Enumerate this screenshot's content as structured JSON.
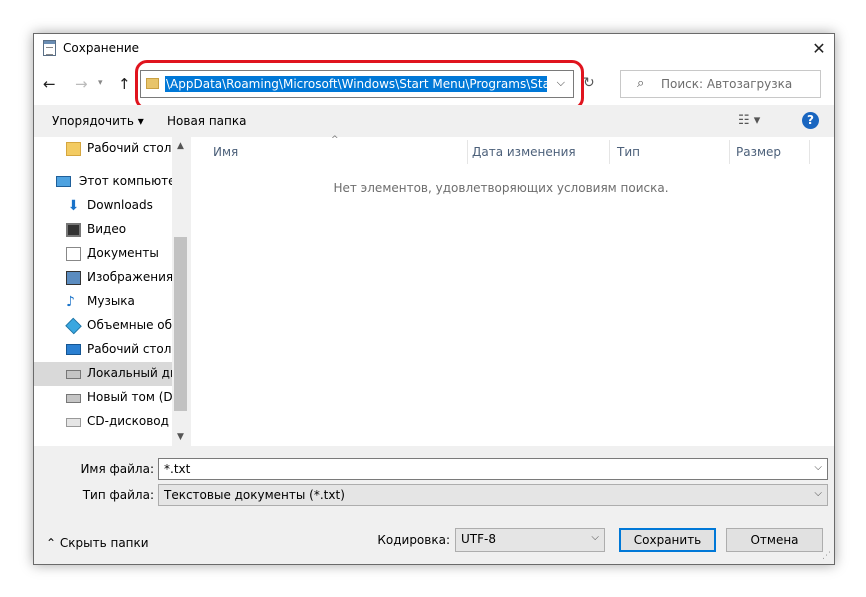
{
  "window": {
    "title": "Сохранение"
  },
  "address": {
    "path": "\\AppData\\Roaming\\Microsoft\\Windows\\Start Menu\\Programs\\Startup"
  },
  "search": {
    "placeholder": "Поиск: Автозагрузка"
  },
  "toolbar": {
    "organize_label": "Упорядочить",
    "new_folder_label": "Новая папка"
  },
  "sidebar": {
    "items": [
      {
        "label": "Рабочий стол",
        "icon": "folder-icon"
      },
      {
        "label": "Этот компьютер",
        "icon": "computer-icon"
      },
      {
        "label": "Downloads",
        "icon": "downloads-icon"
      },
      {
        "label": "Видео",
        "icon": "video-icon"
      },
      {
        "label": "Документы",
        "icon": "documents-icon"
      },
      {
        "label": "Изображения",
        "icon": "pictures-icon"
      },
      {
        "label": "Музыка",
        "icon": "music-icon"
      },
      {
        "label": "Объемные объ",
        "icon": "3d-objects-icon"
      },
      {
        "label": "Рабочий стол",
        "icon": "desktop-icon"
      },
      {
        "label": "Локальный дис",
        "icon": "local-disk-icon",
        "selected": true
      },
      {
        "label": "Новый том (D:)",
        "icon": "drive-icon"
      },
      {
        "label": "CD-дисковод (F",
        "icon": "cd-drive-icon"
      }
    ]
  },
  "columns": {
    "name": "Имя",
    "date": "Дата изменения",
    "type": "Тип",
    "size": "Размер"
  },
  "content": {
    "empty_message": "Нет элементов, удовлетворяющих условиям поиска."
  },
  "form": {
    "filename_label": "Имя файла:",
    "filename_value": "*.txt",
    "filetype_label": "Тип файла:",
    "filetype_value": "Текстовые документы (*.txt)",
    "encoding_label": "Кодировка:",
    "encoding_value": "UTF-8"
  },
  "footer": {
    "hide_folders_label": "Скрыть папки",
    "save_label": "Сохранить",
    "cancel_label": "Отмена"
  },
  "colors": {
    "accent": "#0078d7",
    "highlight": "#e0141e"
  }
}
